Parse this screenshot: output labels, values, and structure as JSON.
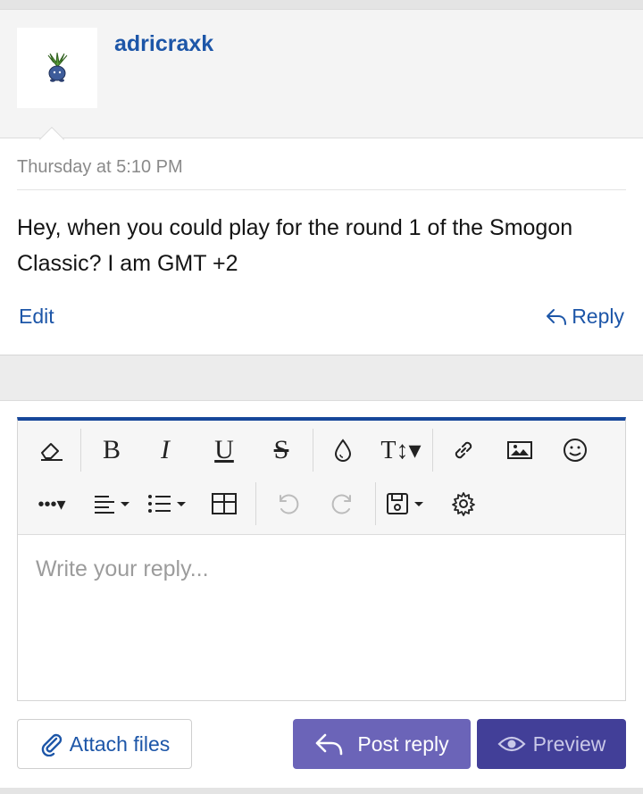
{
  "post": {
    "username": "adricraxk",
    "timestamp": "Thursday at 5:10 PM",
    "message": "Hey, when you could play for the round 1 of the Smogon Classic? I am GMT +2",
    "edit_label": "Edit",
    "reply_label": "Reply",
    "avatar_icon": "oddish-avatar-icon"
  },
  "editor": {
    "placeholder": "Write your reply...",
    "toolbar_row1": [
      "eraser-icon",
      "bold-icon",
      "italic-icon",
      "underline-icon",
      "strikethrough-icon",
      "color-drop-icon",
      "text-size-icon",
      "link-icon",
      "image-icon",
      "smiley-icon"
    ],
    "toolbar_row2": [
      "more-icon",
      "align-icon",
      "list-icon",
      "table-icon",
      "undo-icon",
      "redo-icon",
      "drafts-icon",
      "settings-icon"
    ],
    "accent_color": "#17479a"
  },
  "actions": {
    "attach_label": "Attach files",
    "post_reply_label": "Post reply",
    "preview_label": "Preview",
    "post_reply_color": "#6b64b8",
    "preview_color": "#423f98"
  },
  "colors": {
    "link": "#1d56a8",
    "muted": "#8a8a8a"
  }
}
